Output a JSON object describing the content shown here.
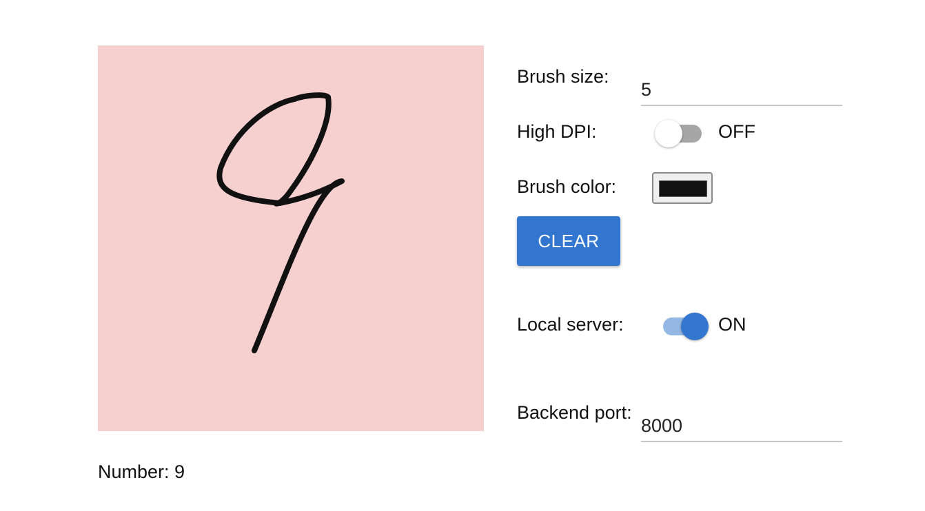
{
  "canvas": {
    "background_color": "#f6cfcf",
    "stroke_color": "#111111"
  },
  "result": {
    "label": "Number: 9"
  },
  "controls": {
    "brush_size": {
      "label": "Brush size:",
      "value": "5"
    },
    "high_dpi": {
      "label": "High DPI:",
      "state_text": "OFF",
      "enabled": false
    },
    "brush_color": {
      "label": "Brush color:",
      "value": "#111111"
    },
    "clear_button": {
      "label": "CLEAR"
    },
    "local_server": {
      "label": "Local server:",
      "state_text": "ON",
      "enabled": true
    },
    "backend_port": {
      "label": "Backend port:",
      "value": "8000"
    }
  },
  "colors": {
    "accent": "#3376d0",
    "switch_off_track": "#a6a6a6",
    "switch_on_track": "#94b7e4"
  }
}
